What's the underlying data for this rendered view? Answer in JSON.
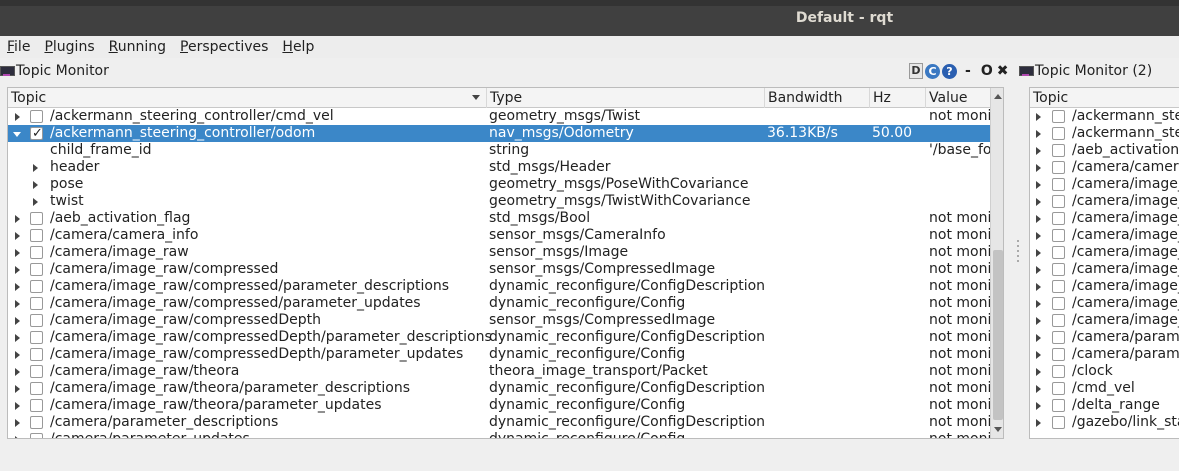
{
  "window": {
    "title": "Default - rqt"
  },
  "menu": [
    {
      "label": "File",
      "mnemonic": "F",
      "rest": "ile"
    },
    {
      "label": "Plugins",
      "mnemonic": "P",
      "rest": "lugins"
    },
    {
      "label": "Running",
      "mnemonic": "R",
      "rest": "unning"
    },
    {
      "label": "Perspectives",
      "mnemonic": "P",
      "rest": "erspectives"
    },
    {
      "label": "Help",
      "mnemonic": "H",
      "rest": "elp"
    }
  ],
  "panel1": {
    "title": "Topic Monitor",
    "controls": {
      "d": "D",
      "c": "C",
      "q": "?",
      "min": "-",
      "restore": "O",
      "close": "✖"
    },
    "columns": {
      "topic": "Topic",
      "type": "Type",
      "bandwidth": "Bandwidth",
      "hz": "Hz",
      "value": "Value"
    },
    "rows": [
      {
        "expander": "right",
        "check": "unchecked",
        "topic": "/ackermann_steering_controller/cmd_vel",
        "type": "geometry_msgs/Twist",
        "bandwidth": "",
        "hz": "",
        "value": "not moni"
      },
      {
        "expander": "down",
        "check": "checked",
        "selected": true,
        "topic": "/ackermann_steering_controller/odom",
        "type": "nav_msgs/Odometry",
        "bandwidth": "36.13KB/s",
        "hz": "50.00",
        "value": ""
      },
      {
        "expander": "none",
        "check": "none",
        "child": true,
        "topic": "child_frame_id",
        "type": "string",
        "bandwidth": "",
        "hz": "",
        "value": "'/base_fo"
      },
      {
        "expander": "right",
        "check": "none",
        "child": true,
        "topic": "header",
        "type": "std_msgs/Header",
        "bandwidth": "",
        "hz": "",
        "value": ""
      },
      {
        "expander": "right",
        "check": "none",
        "child": true,
        "topic": "pose",
        "type": "geometry_msgs/PoseWithCovariance",
        "bandwidth": "",
        "hz": "",
        "value": ""
      },
      {
        "expander": "right",
        "check": "none",
        "child": true,
        "topic": "twist",
        "type": "geometry_msgs/TwistWithCovariance",
        "bandwidth": "",
        "hz": "",
        "value": ""
      },
      {
        "expander": "right",
        "check": "unchecked",
        "topic": "/aeb_activation_flag",
        "type": "std_msgs/Bool",
        "bandwidth": "",
        "hz": "",
        "value": "not moni"
      },
      {
        "expander": "right",
        "check": "unchecked",
        "topic": "/camera/camera_info",
        "type": "sensor_msgs/CameraInfo",
        "bandwidth": "",
        "hz": "",
        "value": "not moni"
      },
      {
        "expander": "right",
        "check": "unchecked",
        "topic": "/camera/image_raw",
        "type": "sensor_msgs/Image",
        "bandwidth": "",
        "hz": "",
        "value": "not moni"
      },
      {
        "expander": "right",
        "check": "unchecked",
        "topic": "/camera/image_raw/compressed",
        "type": "sensor_msgs/CompressedImage",
        "bandwidth": "",
        "hz": "",
        "value": "not moni"
      },
      {
        "expander": "right",
        "check": "unchecked",
        "topic": "/camera/image_raw/compressed/parameter_descriptions",
        "type": "dynamic_reconfigure/ConfigDescription",
        "bandwidth": "",
        "hz": "",
        "value": "not moni"
      },
      {
        "expander": "right",
        "check": "unchecked",
        "topic": "/camera/image_raw/compressed/parameter_updates",
        "type": "dynamic_reconfigure/Config",
        "bandwidth": "",
        "hz": "",
        "value": "not moni"
      },
      {
        "expander": "right",
        "check": "unchecked",
        "topic": "/camera/image_raw/compressedDepth",
        "type": "sensor_msgs/CompressedImage",
        "bandwidth": "",
        "hz": "",
        "value": "not moni"
      },
      {
        "expander": "right",
        "check": "unchecked",
        "topic": "/camera/image_raw/compressedDepth/parameter_descriptions",
        "type": "dynamic_reconfigure/ConfigDescription",
        "bandwidth": "",
        "hz": "",
        "value": "not moni"
      },
      {
        "expander": "right",
        "check": "unchecked",
        "topic": "/camera/image_raw/compressedDepth/parameter_updates",
        "type": "dynamic_reconfigure/Config",
        "bandwidth": "",
        "hz": "",
        "value": "not moni"
      },
      {
        "expander": "right",
        "check": "unchecked",
        "topic": "/camera/image_raw/theora",
        "type": "theora_image_transport/Packet",
        "bandwidth": "",
        "hz": "",
        "value": "not moni"
      },
      {
        "expander": "right",
        "check": "unchecked",
        "topic": "/camera/image_raw/theora/parameter_descriptions",
        "type": "dynamic_reconfigure/ConfigDescription",
        "bandwidth": "",
        "hz": "",
        "value": "not moni"
      },
      {
        "expander": "right",
        "check": "unchecked",
        "topic": "/camera/image_raw/theora/parameter_updates",
        "type": "dynamic_reconfigure/Config",
        "bandwidth": "",
        "hz": "",
        "value": "not moni"
      },
      {
        "expander": "right",
        "check": "unchecked",
        "topic": "/camera/parameter_descriptions",
        "type": "dynamic_reconfigure/ConfigDescription",
        "bandwidth": "",
        "hz": "",
        "value": "not moni"
      },
      {
        "expander": "right",
        "check": "unchecked",
        "topic": "/camera/parameter_updates",
        "type": "dynamic_reconfigure/Config",
        "bandwidth": "",
        "hz": "",
        "value": "not moni"
      }
    ]
  },
  "panel2": {
    "title": "Topic Monitor (2)",
    "columns": {
      "topic": "Topic"
    },
    "rows": [
      {
        "topic": "/ackermann_steering_controller/cmd_vel"
      },
      {
        "topic": "/ackermann_steering_controller/odom"
      },
      {
        "topic": "/aeb_activation_flag"
      },
      {
        "topic": "/camera/camera_info"
      },
      {
        "topic": "/camera/image_raw"
      },
      {
        "topic": "/camera/image_raw/compressed"
      },
      {
        "topic": "/camera/image_raw/compressed/parameter_descriptions"
      },
      {
        "topic": "/camera/image_raw/compressed/parameter_updates"
      },
      {
        "topic": "/camera/image_raw/compressedDepth"
      },
      {
        "topic": "/camera/image_raw/compressedDepth/parameter_descriptions"
      },
      {
        "topic": "/camera/image_raw/compressedDepth/parameter_updates"
      },
      {
        "topic": "/camera/image_raw/theora"
      },
      {
        "topic": "/camera/image_raw/theora/parameter_descriptions"
      },
      {
        "topic": "/camera/parameter_descriptions"
      },
      {
        "topic": "/camera/parameter_updates"
      },
      {
        "topic": "/clock"
      },
      {
        "topic": "/cmd_vel"
      },
      {
        "topic": "/delta_range"
      },
      {
        "topic": "/gazebo/link_states"
      }
    ]
  }
}
